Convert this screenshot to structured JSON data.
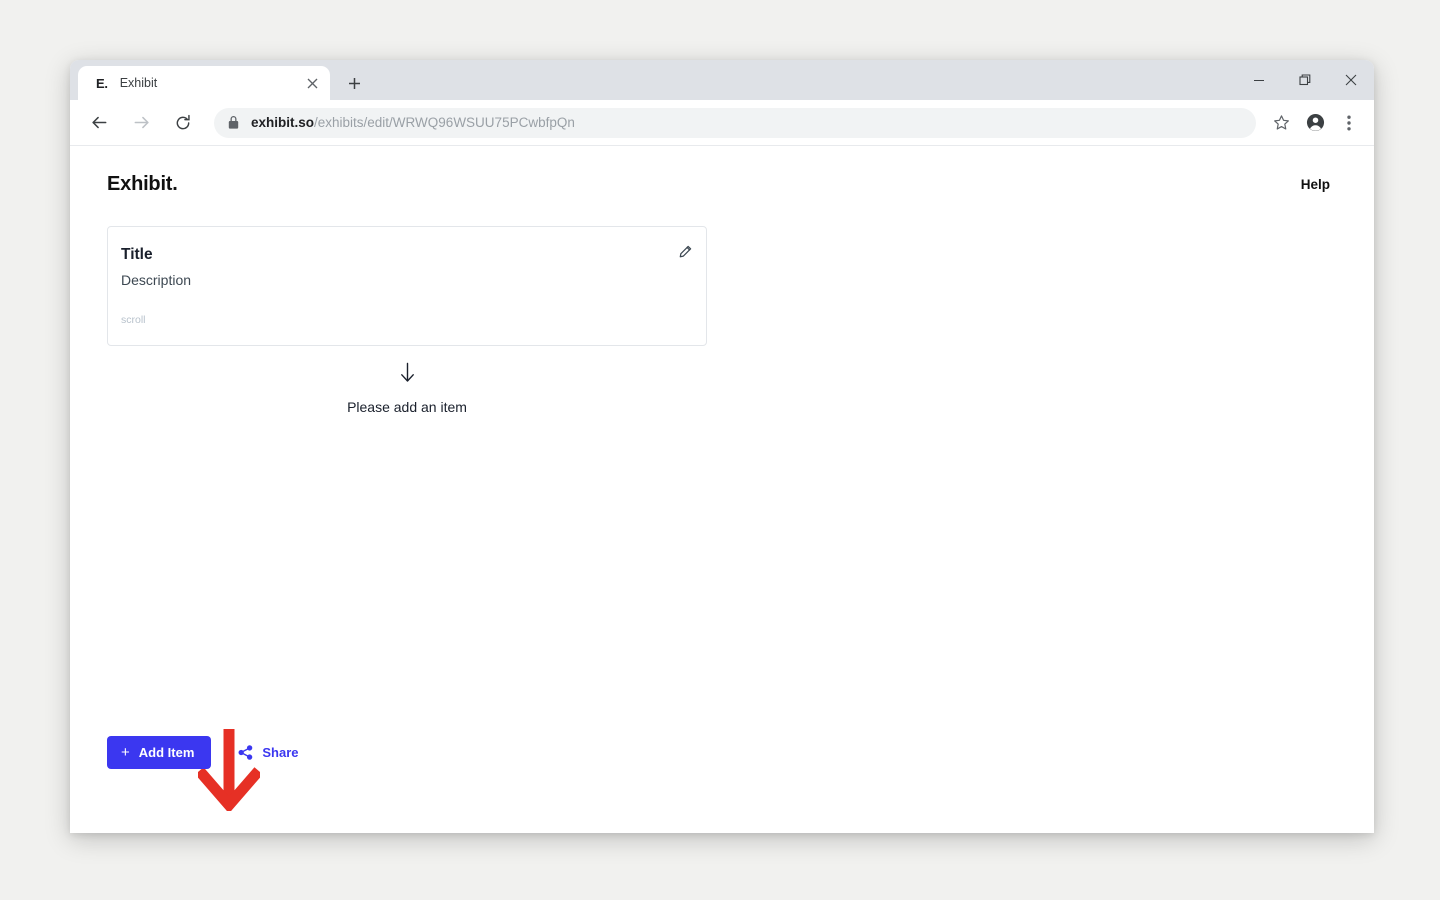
{
  "browser": {
    "tab": {
      "favicon_text": "E.",
      "title": "Exhibit",
      "close_icon": "close-icon"
    },
    "new_tab_icon": "plus-icon",
    "window_controls": {
      "minimize": "minimize-icon",
      "maximize": "restore-icon",
      "close": "close-icon"
    },
    "nav": {
      "back": "back-arrow-icon",
      "forward": "forward-arrow-icon",
      "reload": "reload-icon"
    },
    "omnibox": {
      "lock_icon": "lock-icon",
      "host": "exhibit.so",
      "path": "/exhibits/edit/WRWQ96WSUU75PCwbfpQn"
    },
    "toolbar_icons": {
      "bookmark": "star-icon",
      "profile": "account-avatar-icon",
      "menu": "three-dot-menu-icon"
    }
  },
  "app": {
    "brand": "Exhibit.",
    "help_label": "Help",
    "card": {
      "title": "Title",
      "description": "Description",
      "scroll_label": "scroll",
      "edit_icon": "pencil-icon"
    },
    "empty_state": {
      "arrow": "↓",
      "text": "Please add an item"
    },
    "footer": {
      "add_item_label": "Add Item",
      "add_item_plus": "+",
      "share_label": "Share",
      "share_icon": "share-icon"
    },
    "annotation": {
      "arrow_icon": "red-down-arrow-annotation"
    },
    "colors": {
      "accent": "#3b37f0",
      "annotation": "#e63025",
      "text": "#1a202c",
      "muted": "#b8c2cc"
    }
  }
}
